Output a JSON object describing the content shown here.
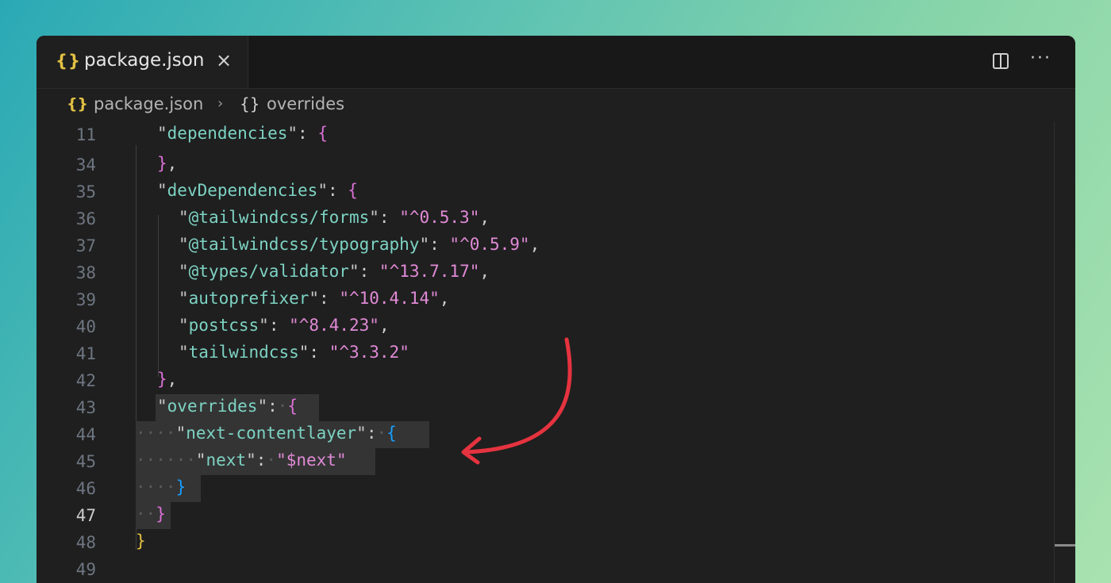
{
  "tab": {
    "icon": "{}",
    "label": "package.json",
    "close": "×"
  },
  "toolbar": {
    "split_icon": "split-editor-icon",
    "more": "···"
  },
  "breadcrumb": {
    "icon1": "{}",
    "file": "package.json",
    "sep": "›",
    "icon2": "{}",
    "node": "overrides"
  },
  "lines": [
    {
      "n": "11"
    },
    {
      "n": "34"
    },
    {
      "n": "35"
    },
    {
      "n": "36"
    },
    {
      "n": "37"
    },
    {
      "n": "38"
    },
    {
      "n": "39"
    },
    {
      "n": "40"
    },
    {
      "n": "41"
    },
    {
      "n": "42"
    },
    {
      "n": "43"
    },
    {
      "n": "44"
    },
    {
      "n": "45"
    },
    {
      "n": "46"
    },
    {
      "n": "47"
    },
    {
      "n": "48"
    },
    {
      "n": "49"
    }
  ],
  "code": {
    "l11_key": "dependencies",
    "l35_key": "devDependencies",
    "l36_key": "@tailwindcss/forms",
    "l36_val": "^0.5.3",
    "l37_key": "@tailwindcss/typography",
    "l37_val": "^0.5.9",
    "l38_key": "@types/validator",
    "l38_val": "^13.7.17",
    "l39_key": "autoprefixer",
    "l39_val": "^10.4.14",
    "l40_key": "postcss",
    "l40_val": "^8.4.23",
    "l41_key": "tailwindcss",
    "l41_val": "^3.3.2",
    "l43_key": "overrides",
    "l44_key": "next-contentlayer",
    "l45_key": "next",
    "l45_val": "$next"
  },
  "colors": {
    "accent_arrow": "#e5333f",
    "key": "#7dd3c3",
    "string": "#e08ad6"
  }
}
